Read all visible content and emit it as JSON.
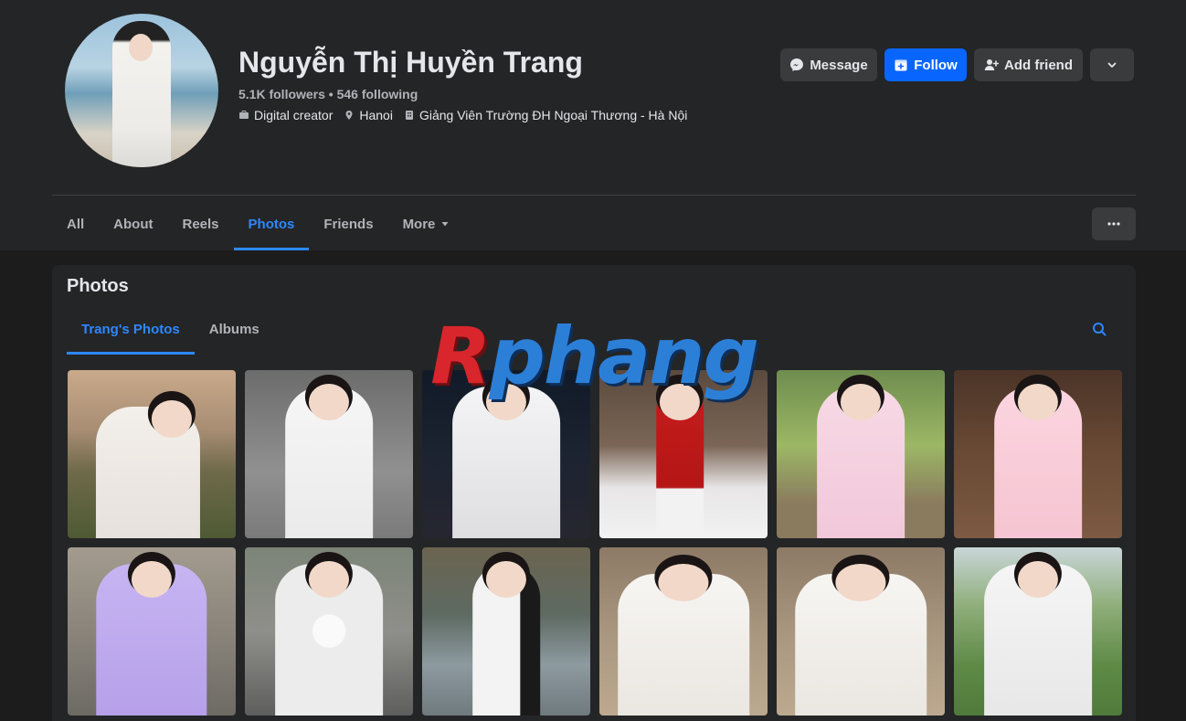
{
  "profile": {
    "name": "Nguyễn Thị Huyền Trang",
    "stats": "5.1K followers • 546 following",
    "category": "Digital creator",
    "location": "Hanoi",
    "workplace": "Giảng Viên Trường ĐH Ngoại Thương - Hà Nội",
    "avatar_icon": "profile-photo"
  },
  "actions": {
    "message_label": "Message",
    "follow_label": "Follow",
    "add_friend_label": "Add friend"
  },
  "tabs": [
    {
      "label": "All"
    },
    {
      "label": "About"
    },
    {
      "label": "Reels"
    },
    {
      "label": "Photos"
    },
    {
      "label": "Friends"
    },
    {
      "label": "More"
    }
  ],
  "photos_section": {
    "title": "Photos",
    "subtabs": [
      {
        "label": "Trang's Photos"
      },
      {
        "label": "Albums"
      }
    ]
  },
  "watermark": {
    "first": "R",
    "rest": "phang"
  },
  "colors": {
    "accent": "#2d88ff",
    "follow_button": "#0866ff",
    "background": "#1c1c1d",
    "surface": "#242526"
  }
}
